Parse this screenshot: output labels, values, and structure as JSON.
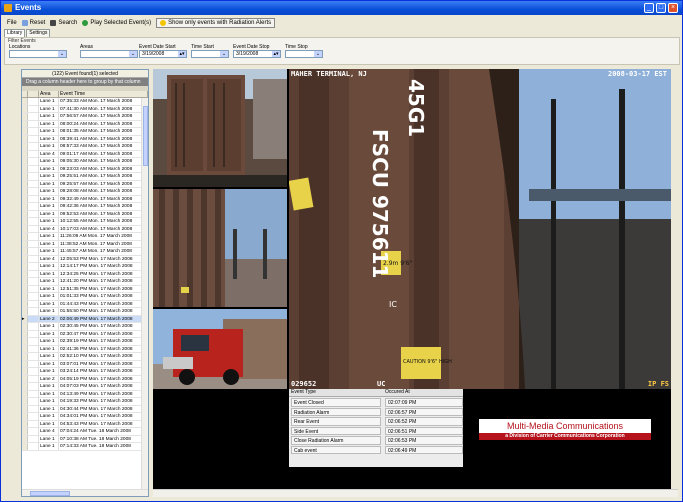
{
  "window": {
    "title": "Events"
  },
  "toolbar": {
    "file": "File",
    "reset": "Reset",
    "search": "Search",
    "play": "Play Selected Event(s)",
    "radiation_only": "Show only events with Radiation Alerts"
  },
  "tabs": [
    "Library",
    "Settings"
  ],
  "filter": {
    "title": "Filter Events",
    "locations_label": "Locations",
    "areas_label": "Areas",
    "date_start_label": "Event Date Start",
    "date_start_value": "3/19/2008",
    "time_start_label": "Time Start",
    "date_stop_label": "Event Date Stop",
    "date_stop_value": "3/19/2008",
    "time_stop_label": "Time Stop"
  },
  "events_list": {
    "count": "(122) Event found(1) selected",
    "group_hint": "Drag a column header here to group by that column",
    "headers": [
      "Area",
      "Event Time"
    ],
    "rows": [
      [
        "Lane 1",
        "07:35:33 AM Mon. 17 March 2008"
      ],
      [
        "Lane 1",
        "07:41:30 AM Mon. 17 March 2008"
      ],
      [
        "Lane 1",
        "07:56:57 AM Mon. 17 March 2008"
      ],
      [
        "Lane 1",
        "08:00:24 AM Mon. 17 March 2008"
      ],
      [
        "Lane 1",
        "08:01:35 AM Mon. 17 March 2008"
      ],
      [
        "Lane 1",
        "08:39:41 AM Mon. 17 March 2008"
      ],
      [
        "Lane 1",
        "08:57:33 AM Mon. 17 March 2008"
      ],
      [
        "Lane 4",
        "09:01:17 AM Mon. 17 March 2008"
      ],
      [
        "Lane 1",
        "09:05:30 AM Mon. 17 March 2008"
      ],
      [
        "Lane 1",
        "09:23:03 AM Mon. 17 March 2008"
      ],
      [
        "Lane 1",
        "09:25:51 AM Mon. 17 March 2008"
      ],
      [
        "Lane 1",
        "09:25:57 AM Mon. 17 March 2008"
      ],
      [
        "Lane 1",
        "09:28:08 AM Mon. 17 March 2008"
      ],
      [
        "Lane 1",
        "09:32:49 AM Mon. 17 March 2008"
      ],
      [
        "Lane 1",
        "09:42:36 AM Mon. 17 March 2008"
      ],
      [
        "Lane 1",
        "09:52:53 AM Mon. 17 March 2008"
      ],
      [
        "Lane 1",
        "10:12:55 AM Mon. 17 March 2008"
      ],
      [
        "Lane 4",
        "10:17:03 AM Mon. 17 March 2008"
      ],
      [
        "Lane 1",
        "11:26:09 AM Mon. 17 March 2008"
      ],
      [
        "Lane 1",
        "11:38:52 AM Mon. 17 March 2008"
      ],
      [
        "Lane 1",
        "11:45:57 AM Mon. 17 March 2008"
      ],
      [
        "Lane 4",
        "12:05:53 PM Mon. 17 March 2008"
      ],
      [
        "Lane 1",
        "12:14:17 PM Mon. 17 March 2008"
      ],
      [
        "Lane 1",
        "12:34:25 PM Mon. 17 March 2008"
      ],
      [
        "Lane 1",
        "12:41:20 PM Mon. 17 March 2008"
      ],
      [
        "Lane 1",
        "12:51:35 PM Mon. 17 March 2008"
      ],
      [
        "Lane 1",
        "01:01:33 PM Mon. 17 March 2008"
      ],
      [
        "Lane 1",
        "01:44:43 PM Mon. 17 March 2008"
      ],
      [
        "Lane 1",
        "01:55:50 PM Mon. 17 March 2008"
      ],
      [
        "Lane 2",
        "02:06:49 PM Mon. 17 March 2008"
      ],
      [
        "Lane 1",
        "02:30:45 PM Mon. 17 March 2008"
      ],
      [
        "Lane 1",
        "02:30:47 PM Mon. 17 March 2008"
      ],
      [
        "Lane 1",
        "02:39:19 PM Mon. 17 March 2008"
      ],
      [
        "Lane 1",
        "02:41:36 PM Mon. 17 March 2008"
      ],
      [
        "Lane 1",
        "02:52:10 PM Mon. 17 March 2008"
      ],
      [
        "Lane 1",
        "03:07:01 PM Mon. 17 March 2008"
      ],
      [
        "Lane 1",
        "03:24:14 PM Mon. 17 March 2008"
      ],
      [
        "Lane 2",
        "04:05:19 PM Mon. 17 March 2008"
      ],
      [
        "Lane 1",
        "04:07:03 PM Mon. 17 March 2008"
      ],
      [
        "Lane 1",
        "04:13:49 PM Mon. 17 March 2008"
      ],
      [
        "Lane 1",
        "04:19:33 PM Mon. 17 March 2008"
      ],
      [
        "Lane 1",
        "04:30:44 PM Mon. 17 March 2008"
      ],
      [
        "Lane 1",
        "04:34:01 PM Mon. 17 March 2008"
      ],
      [
        "Lane 1",
        "04:53:43 PM Mon. 17 March 2008"
      ],
      [
        "Lane 4",
        "07:04:24 AM Tue. 18 March 2008"
      ],
      [
        "Lane 1",
        "07:10:38 AM Tue. 18 March 2008"
      ],
      [
        "Lane 1",
        "07:14:33 AM Tue. 18 March 2008"
      ]
    ],
    "selected_index": 29
  },
  "camera": {
    "main_title": "MAHER TERMINAL, NJ",
    "main_date": "2008-03-17 EST",
    "main_bottom_left": "029652",
    "main_bottom_mid": "UC",
    "main_bottom_right": "IP FS",
    "container_id_1": "FSCU 975611",
    "container_id_2": "45G1",
    "container_weight": "2.9m 9'6\"",
    "container_caution": "CAUTION 9'6\" HIGH",
    "container_ic": "IC"
  },
  "event_table": {
    "headers": [
      "Event Type",
      "Occured At"
    ],
    "rows": [
      [
        "Event Closed",
        "02:07:09 PM"
      ],
      [
        "Radiation Alarm",
        "02:06:57 PM"
      ],
      [
        "Rear Event",
        "02:06:52 PM"
      ],
      [
        "Side Event",
        "02:06:51 PM"
      ],
      [
        "Close Radiation Alarm",
        "02:06:53 PM"
      ],
      [
        "Cab event",
        "02:06:49 PM"
      ]
    ]
  },
  "banner": {
    "company": "Multi-Media Communications",
    "subtitle": "a Division of Carrier Communications Corporation"
  }
}
